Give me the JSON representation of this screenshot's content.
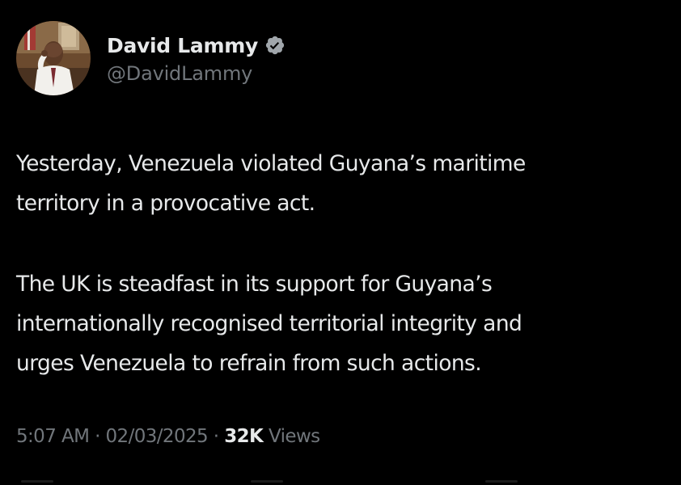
{
  "author": {
    "display_name": "David Lammy",
    "handle": "@DavidLammy",
    "verified": true,
    "verified_icon": "verified-badge-icon",
    "verified_color": "#a0a6ab"
  },
  "tweet": {
    "paragraph_1_line_1": "Yesterday, Venezuela violated Guyana’s maritime",
    "paragraph_1_line_2": "territory in a provocative act.",
    "paragraph_2_line_1": "The UK is steadfast in its support for Guyana’s",
    "paragraph_2_line_2": "internationally recognised territorial integrity and",
    "paragraph_2_line_3": "urges Venezuela to refrain from such actions."
  },
  "meta": {
    "time": "5:07 AM",
    "separator": "·",
    "date": "02/03/2025",
    "views_count": "32K",
    "views_label": "Views"
  },
  "colors": {
    "background": "#000000",
    "primary_text": "#e7e9ea",
    "secondary_text": "#71767b"
  }
}
